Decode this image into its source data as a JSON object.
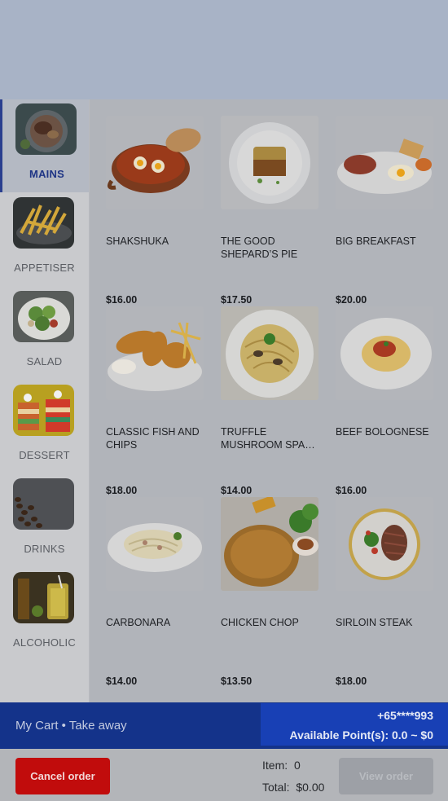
{
  "categories": [
    {
      "label": "MAINS",
      "active": true,
      "icon": "mains-thumbnail"
    },
    {
      "label": "APPETISER",
      "active": false,
      "icon": "fries-thumbnail"
    },
    {
      "label": "SALAD",
      "active": false,
      "icon": "salad-thumbnail"
    },
    {
      "label": "DESSERT",
      "active": false,
      "icon": "cake-thumbnail"
    },
    {
      "label": "DRINKS",
      "active": false,
      "icon": "coffee-beans-thumbnail"
    },
    {
      "label": "ALCOHOLIC",
      "active": false,
      "icon": "cocktail-thumbnail"
    }
  ],
  "menu": [
    {
      "name": "SHAKSHUKA",
      "price": "$16.00"
    },
    {
      "name": "THE GOOD SHEPARD’S PIE",
      "price": "$17.50"
    },
    {
      "name": "BIG BREAKFAST",
      "price": "$20.00"
    },
    {
      "name": "CLASSIC FISH AND CHIPS",
      "price": "$18.00"
    },
    {
      "name": "TRUFFLE MUSHROOM SPA…",
      "price": "$14.00"
    },
    {
      "name": "BEEF BOLOGNESE",
      "price": "$16.00"
    },
    {
      "name": "CARBONARA",
      "price": "$14.00"
    },
    {
      "name": "CHICKEN CHOP",
      "price": "$13.50"
    },
    {
      "name": "SIRLOIN STEAK",
      "price": "$18.00"
    }
  ],
  "cart": {
    "title": "My Cart • Take away",
    "phone": "+65****993",
    "points": "Available Point(s): 0.0 ~ $0"
  },
  "footer": {
    "cancel_label": "Cancel order",
    "item_label": "Item:",
    "item_value": "0",
    "total_label": "Total:",
    "total_value": "$0.00",
    "view_label": "View order"
  },
  "colors": {
    "brand_blue": "#14338a",
    "points_blue": "#1840b5",
    "cancel_red": "#c10c0c",
    "active_category": "#1f3585"
  }
}
